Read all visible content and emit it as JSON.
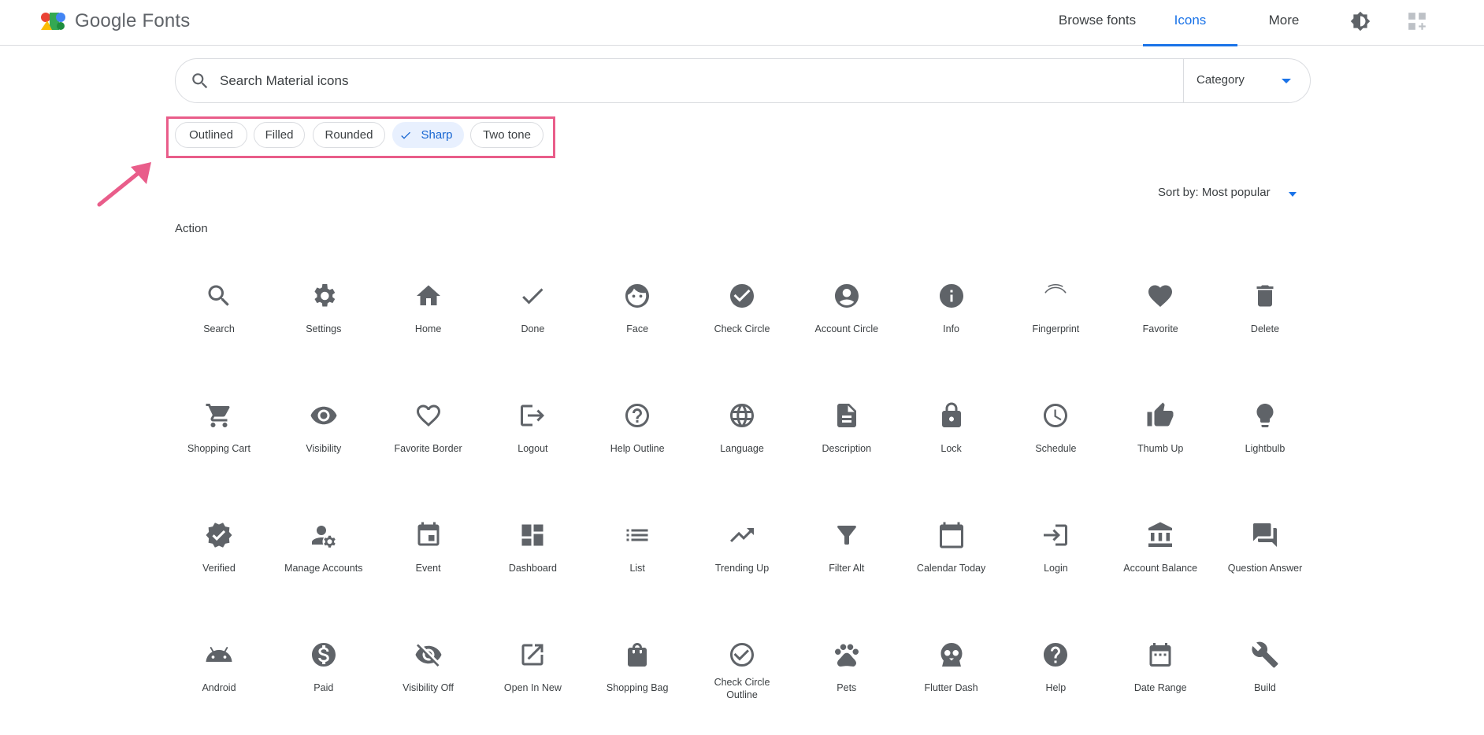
{
  "header": {
    "brand": "Google Fonts",
    "nav": {
      "browse": "Browse fonts",
      "icons": "Icons",
      "more": "More"
    },
    "icons": {
      "theme": "brightness-icon",
      "apps": "add-apps-icon"
    }
  },
  "search": {
    "placeholder": "Search Material icons",
    "value": "",
    "category_label": "Category"
  },
  "style_chips": {
    "outlined": "Outlined",
    "filled": "Filled",
    "rounded": "Rounded",
    "sharp": "Sharp",
    "twotone": "Two tone",
    "selected": "Sharp"
  },
  "sort": {
    "label": "Sort by: Most popular"
  },
  "section": {
    "title": "Action"
  },
  "colors": {
    "accent": "#1a73e8",
    "highlight_box": "#e95d8a",
    "icon": "#5f6368"
  },
  "icons": [
    [
      "Search",
      "Settings",
      "Home",
      "Done",
      "Face",
      "Check Circle",
      "Account Circle",
      "Info",
      "Fingerprint",
      "Favorite",
      "Delete"
    ],
    [
      "Shopping Cart",
      "Visibility",
      "Favorite Border",
      "Logout",
      "Help Outline",
      "Language",
      "Description",
      "Lock",
      "Schedule",
      "Thumb Up",
      "Lightbulb"
    ],
    [
      "Verified",
      "Manage Accounts",
      "Event",
      "Dashboard",
      "List",
      "Trending Up",
      "Filter Alt",
      "Calendar Today",
      "Login",
      "Account Balance",
      "Question Answer"
    ],
    [
      "Android",
      "Paid",
      "Visibility Off",
      "Open In New",
      "Shopping Bag",
      "Check Circle Outline",
      "Pets",
      "Flutter Dash",
      "Help",
      "Date Range",
      "Build"
    ]
  ]
}
